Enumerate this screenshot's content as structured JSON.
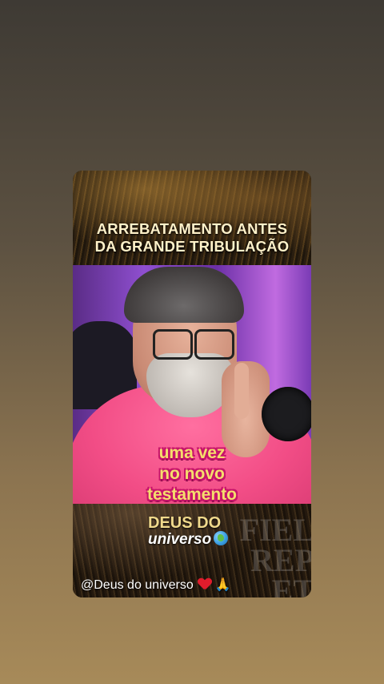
{
  "post": {
    "headline_line1": "ARREBATAMENTO ANTES",
    "headline_line2": "DA GRANDE TRIBULAÇÃO",
    "caption_lines": [
      "uma vez",
      "no novo",
      "testamento"
    ],
    "brand_top": "DEUS DO",
    "brand_bottom": "universo",
    "handle": "@Deus do universo",
    "ghost_lines": [
      "FIEL",
      "REP",
      "ET"
    ]
  },
  "icons": {
    "brand_emoji": "globe-icon",
    "handle_emoji_1": "heart-icon",
    "handle_emoji_2": "praying-hands-icon"
  },
  "colors": {
    "caption_fill": "#f5de6c",
    "caption_outline": "#c6146a",
    "brand_gold": "#f0d98c"
  }
}
